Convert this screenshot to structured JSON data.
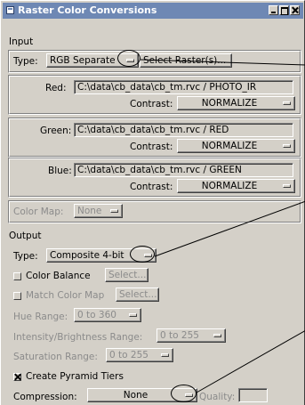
{
  "window": {
    "title": "Raster Color Conversions"
  },
  "input": {
    "section_label": "Input",
    "type_label": "Type:",
    "type_value": "RGB Separate",
    "select_raster_label": "Select Raster(s)...",
    "red": {
      "label": "Red:",
      "path": "C:\\data\\cb_data\\cb_tm.rvc / PHOTO_IR",
      "contrast_label": "Contrast:",
      "contrast_value": "NORMALIZE"
    },
    "green": {
      "label": "Green:",
      "path": "C:\\data\\cb_data\\cb_tm.rvc / RED",
      "contrast_label": "Contrast:",
      "contrast_value": "NORMALIZE"
    },
    "blue": {
      "label": "Blue:",
      "path": "C:\\data\\cb_data\\cb_tm.rvc / GREEN",
      "contrast_label": "Contrast:",
      "contrast_value": "NORMALIZE"
    },
    "color_map_label": "Color Map:",
    "color_map_value": "None"
  },
  "output": {
    "section_label": "Output",
    "type_label": "Type:",
    "type_value": "Composite 4-bit",
    "color_balance_label": "Color Balance",
    "color_balance_button": "Select...",
    "match_color_map_label": "Match Color Map",
    "match_color_map_button": "Select...",
    "hue_range_label": "Hue Range:",
    "hue_range_value": "0 to 360",
    "intensity_label": "Intensity/Brightness Range:",
    "intensity_value": "0 to 255",
    "saturation_label": "Saturation Range:",
    "saturation_value": "0 to 255",
    "pyramid_label": "Create Pyramid Tiers",
    "pyramid_checked": true,
    "compression_label": "Compression:",
    "compression_value": "None",
    "quality_label": "Quality:",
    "quality_value": ""
  },
  "icons": {
    "app": "window-menu-icon",
    "minimize": "minimize-icon",
    "maximize": "maximize-icon",
    "close": "close-icon",
    "option_indicator": "option-menu-indicator-icon"
  },
  "colors": {
    "titlebar": "#6e88b4",
    "panel": "#d4d0c8",
    "disabled_text": "#8b8b8b"
  }
}
